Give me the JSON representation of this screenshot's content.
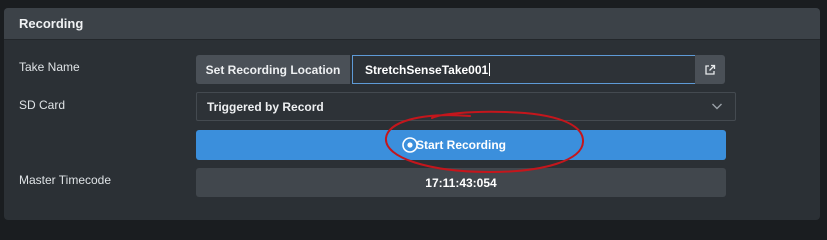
{
  "panel": {
    "title": "Recording"
  },
  "rows": {
    "take_name_label": "Take Name",
    "sd_card_label": "SD Card",
    "master_timecode_label": "Master Timecode"
  },
  "take": {
    "set_location_label": "Set Recording Location",
    "value": "StretchSenseTake001"
  },
  "sd_card": {
    "selected": "Triggered by Record"
  },
  "start_button": {
    "label": "Start Recording"
  },
  "timecode": {
    "value": "17:11:43:054"
  },
  "colors": {
    "accent": "#3b8fdc",
    "annotation": "#c4161c"
  },
  "icons": [
    "external-link-icon",
    "chevron-down-icon",
    "record-icon"
  ]
}
